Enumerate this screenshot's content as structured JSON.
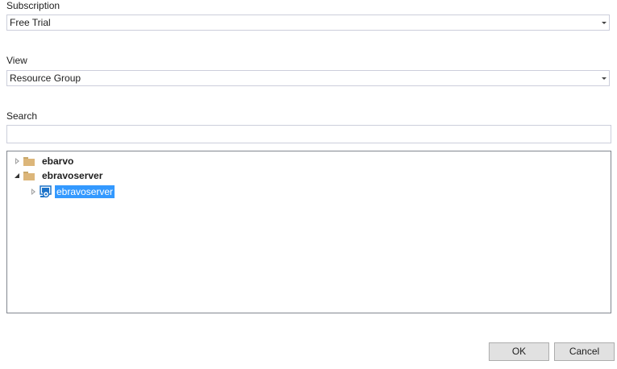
{
  "subscription": {
    "label": "Subscription",
    "selected": "Free Trial"
  },
  "view": {
    "label": "View",
    "selected": "Resource Group"
  },
  "search": {
    "label": "Search",
    "value": ""
  },
  "tree": {
    "nodes": [
      {
        "label": "ebarvo",
        "state": "collapsed",
        "icon": "folder-icon"
      },
      {
        "label": "ebravoserver",
        "state": "expanded",
        "icon": "folder-icon"
      },
      {
        "label": "ebravoserver",
        "state": "collapsed",
        "icon": "sql-server-icon",
        "selected": true
      }
    ]
  },
  "buttons": {
    "ok": "OK",
    "cancel": "Cancel"
  },
  "colors": {
    "selection": "#3399ff",
    "folder": "#dcb67a",
    "server_icon": "#1e74c9"
  }
}
